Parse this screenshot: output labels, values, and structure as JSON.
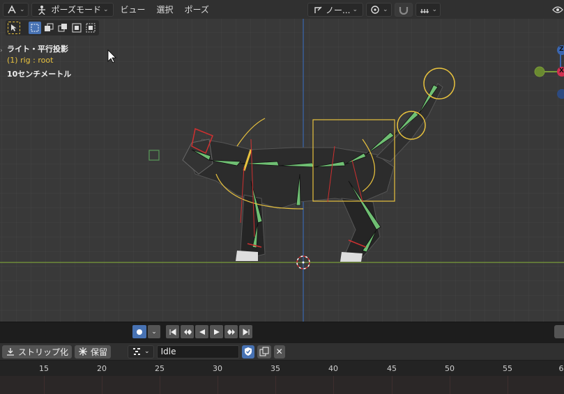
{
  "header": {
    "mode_label": "ポーズモード",
    "menu": [
      "ビュー",
      "選択",
      "ポーズ"
    ],
    "transform_orientation": "ノー..."
  },
  "overlay": {
    "view_label": "ライト・平行投影",
    "object_label": "(1) rig : root",
    "scale_label": "10センチメートル"
  },
  "gizmo": {
    "z": "Z",
    "x": "X"
  },
  "nla": {
    "strip_label": "ストリップ化",
    "freeze_label": "保留",
    "action_name": "Idle"
  },
  "ruler": {
    "ticks": [
      "15",
      "20",
      "25",
      "30",
      "35",
      "40",
      "45",
      "50",
      "55",
      "6"
    ]
  },
  "colors": {
    "accent": "#4772b3",
    "selected_text": "#e8c23e",
    "bone_green": "#6fbf73",
    "bone_yellow": "#e8c23e",
    "bone_red": "#d03030"
  }
}
